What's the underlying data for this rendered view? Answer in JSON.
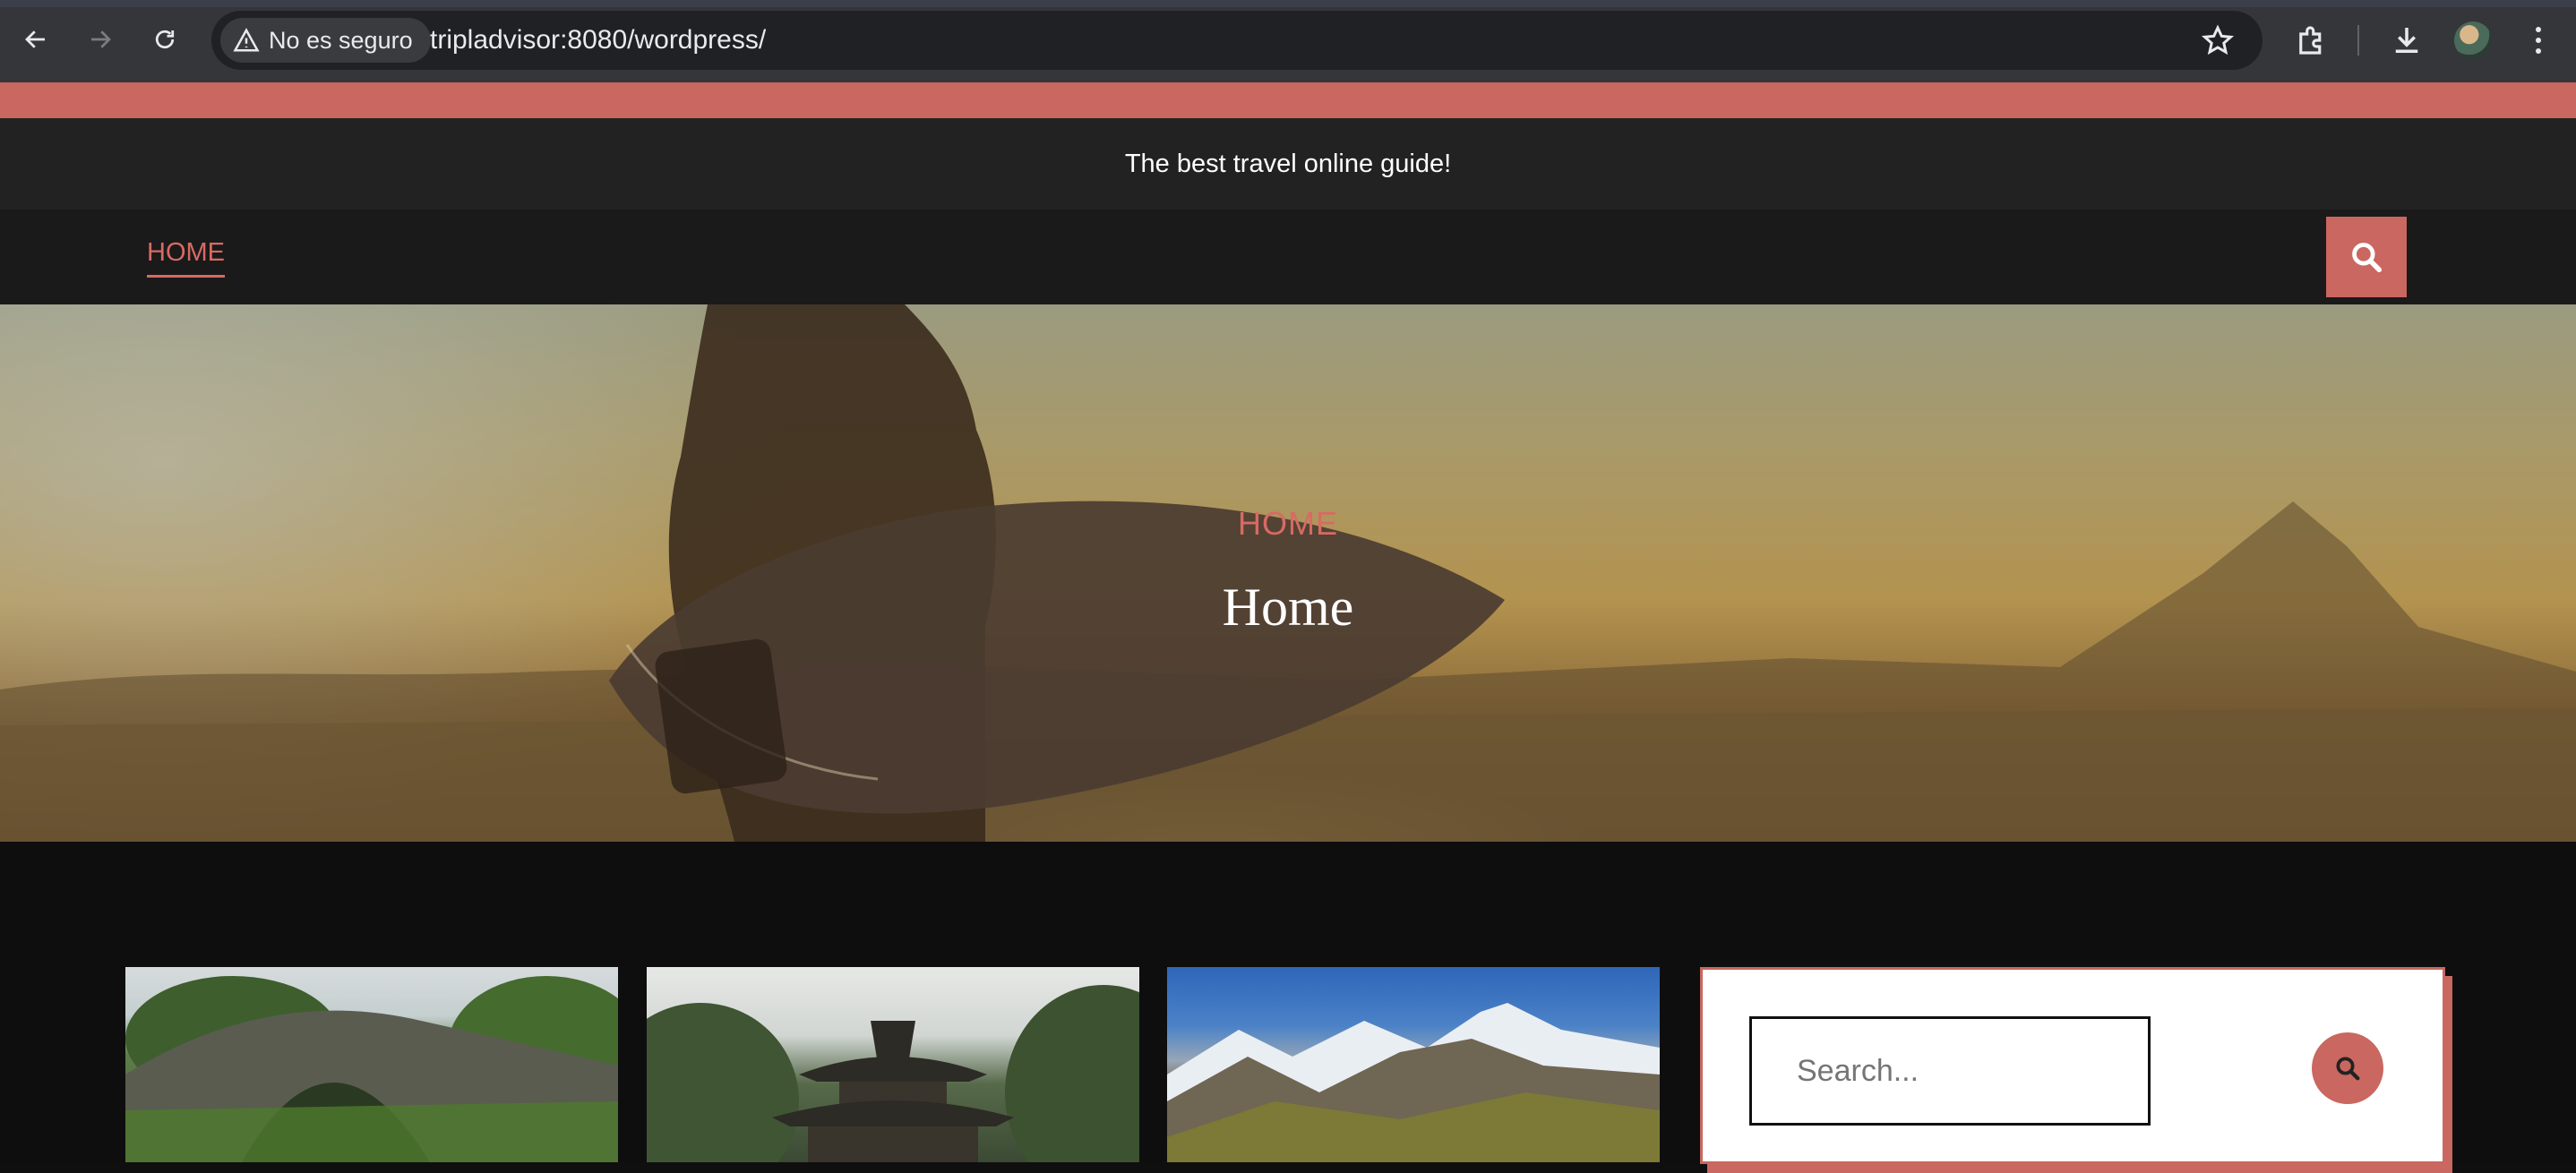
{
  "browser": {
    "security_label": "No es seguro",
    "url_host": "tripladvisor",
    "url_rest": ":8080/wordpress/",
    "icons": [
      "back-icon",
      "forward-icon",
      "reload-icon",
      "warning-icon",
      "star-icon",
      "extensions-icon",
      "download-icon",
      "avatar",
      "menu-icon"
    ]
  },
  "site": {
    "tagline": "The best travel online guide!",
    "nav": [
      {
        "label": "HOME",
        "active": true
      }
    ],
    "accent_color": "#c96760"
  },
  "hero": {
    "breadcrumb": "HOME",
    "title": "Home"
  },
  "sidebar": {
    "search_placeholder": "Search..."
  }
}
